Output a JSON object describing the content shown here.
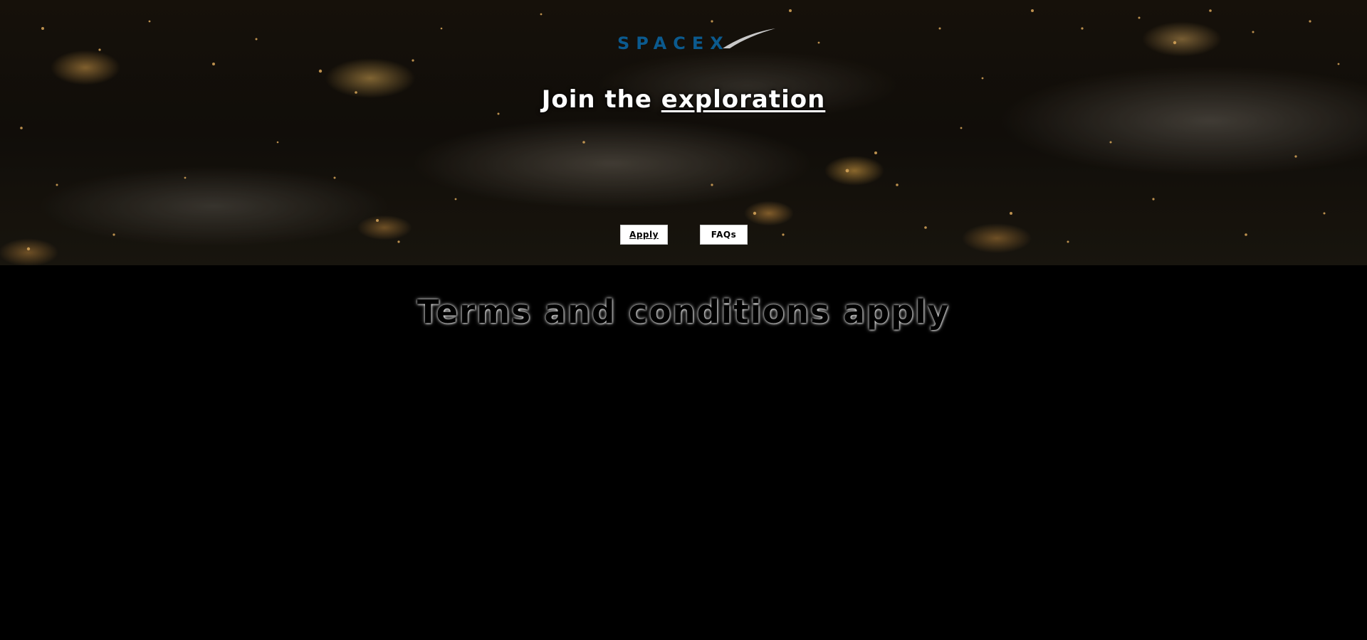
{
  "logo": {
    "text": "SPACEX",
    "color": "#0b5a8e",
    "swoosh_color": "#c8c8c8"
  },
  "hero": {
    "headline_prefix": "Join the ",
    "headline_link": "exploration"
  },
  "buttons": {
    "apply_label": "Apply",
    "faqs_label": "FAQs"
  },
  "footer": {
    "terms_text": "Terms and conditions apply"
  },
  "colors": {
    "background": "#000000",
    "button_bg": "#ffffff",
    "headline": "#ffffff"
  }
}
